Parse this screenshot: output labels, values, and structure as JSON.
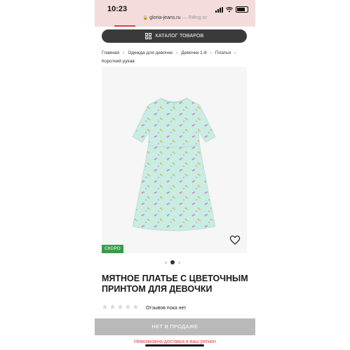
{
  "status_bar": {
    "time": "10:23",
    "url": "gloria-jeans.ru",
    "url_suffix": "— Riêng tư"
  },
  "catalog": {
    "label": "КАТАЛОГ ТОВАРОВ"
  },
  "breadcrumb": {
    "items": [
      "Главная",
      "Одежда для девочек",
      "Девочки 1-8",
      "Платья",
      "Короткий рукав"
    ]
  },
  "product": {
    "badge": "СКОРО",
    "title_line1": "МЯТНОЕ ПЛАТЬЕ С ЦВЕТОЧНЫМ",
    "title_line2": "ПРИНТОМ ДЛЯ ДЕВОЧКИ",
    "reviews_text": "Отзывов пока нет",
    "rating": 0,
    "rating_max": 5,
    "image_count": 3,
    "active_image": 1
  },
  "actions": {
    "sale_label": "НЕТ В ПРОДАЖЕ",
    "delivery_notice": "Невозможна доставка в ваш регион"
  },
  "colors": {
    "accent_red": "#e23d3d",
    "badge_green": "#3b9a48",
    "dress_mint": "#c9ece3"
  }
}
